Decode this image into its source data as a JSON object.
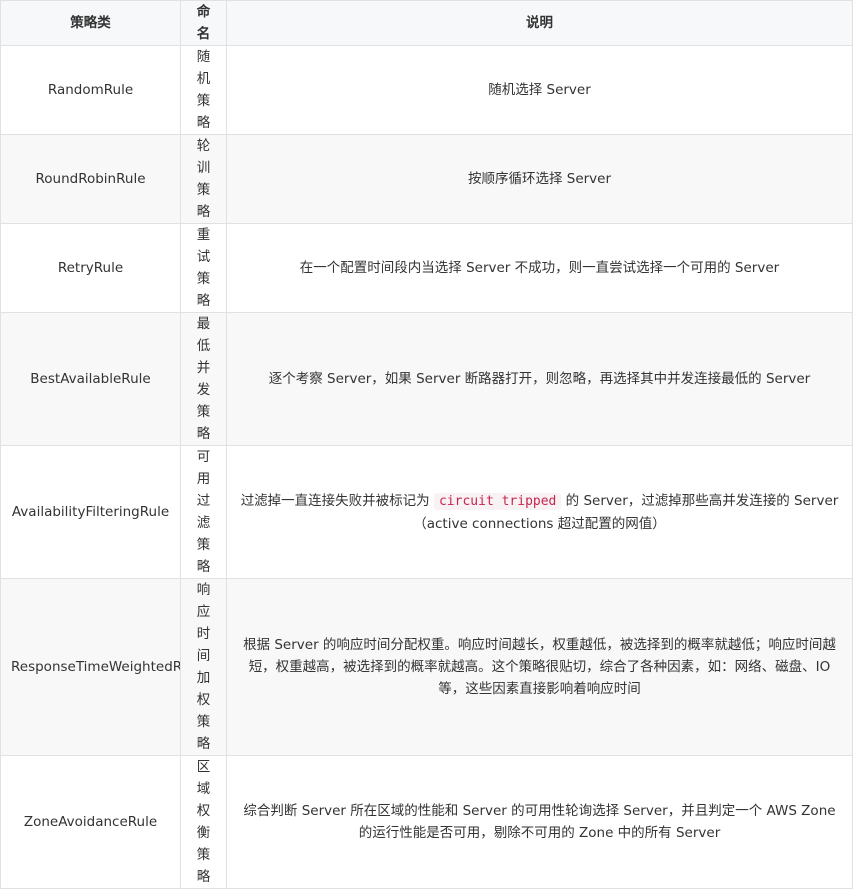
{
  "table": {
    "headers": {
      "name": "策略类",
      "alias": "命名",
      "description": "说明"
    },
    "rows": [
      {
        "name": "RandomRule",
        "alias": "随机策略",
        "description": "随机选择 Server"
      },
      {
        "name": "RoundRobinRule",
        "alias": "轮训策略",
        "description": "按顺序循环选择 Server"
      },
      {
        "name": "RetryRule",
        "alias": "重试策略",
        "description": "在一个配置时间段内当选择 Server 不成功，则一直尝试选择一个可用的 Server"
      },
      {
        "name": "BestAvailableRule",
        "alias": "最低并发策略",
        "description": "逐个考察 Server，如果 Server 断路器打开，则忽略，再选择其中并发连接最低的 Server"
      },
      {
        "name": "AvailabilityFilteringRule",
        "alias": "可用过滤策略",
        "description_before": "过滤掉一直连接失败并被标记为 ",
        "description_code": "circuit tripped",
        "description_after": " 的 Server，过滤掉那些高并发连接的 Server（active connections 超过配置的网值）"
      },
      {
        "name": "ResponseTimeWeightedRule",
        "alias": "响应时间加权策略",
        "description": "根据 Server 的响应时间分配权重。响应时间越长，权重越低，被选择到的概率就越低；响应时间越短，权重越高，被选择到的概率就越高。这个策略很贴切，综合了各种因素，如：网络、磁盘、IO等，这些因素直接影响着响应时间"
      },
      {
        "name": "ZoneAvoidanceRule",
        "alias": "区域权衡策略",
        "description": "综合判断 Server 所在区域的性能和 Server 的可用性轮询选择 Server，并且判定一个 AWS Zone 的运行性能是否可用，剔除不可用的 Zone 中的所有 Server"
      }
    ]
  },
  "colors": {
    "header_bg": "#f6f8fa",
    "border": "#dfe2e5",
    "stripe_bg": "#f8f8f8",
    "text": "#333333",
    "code_text": "#c7254e",
    "code_bg": "#f9f2f4"
  }
}
